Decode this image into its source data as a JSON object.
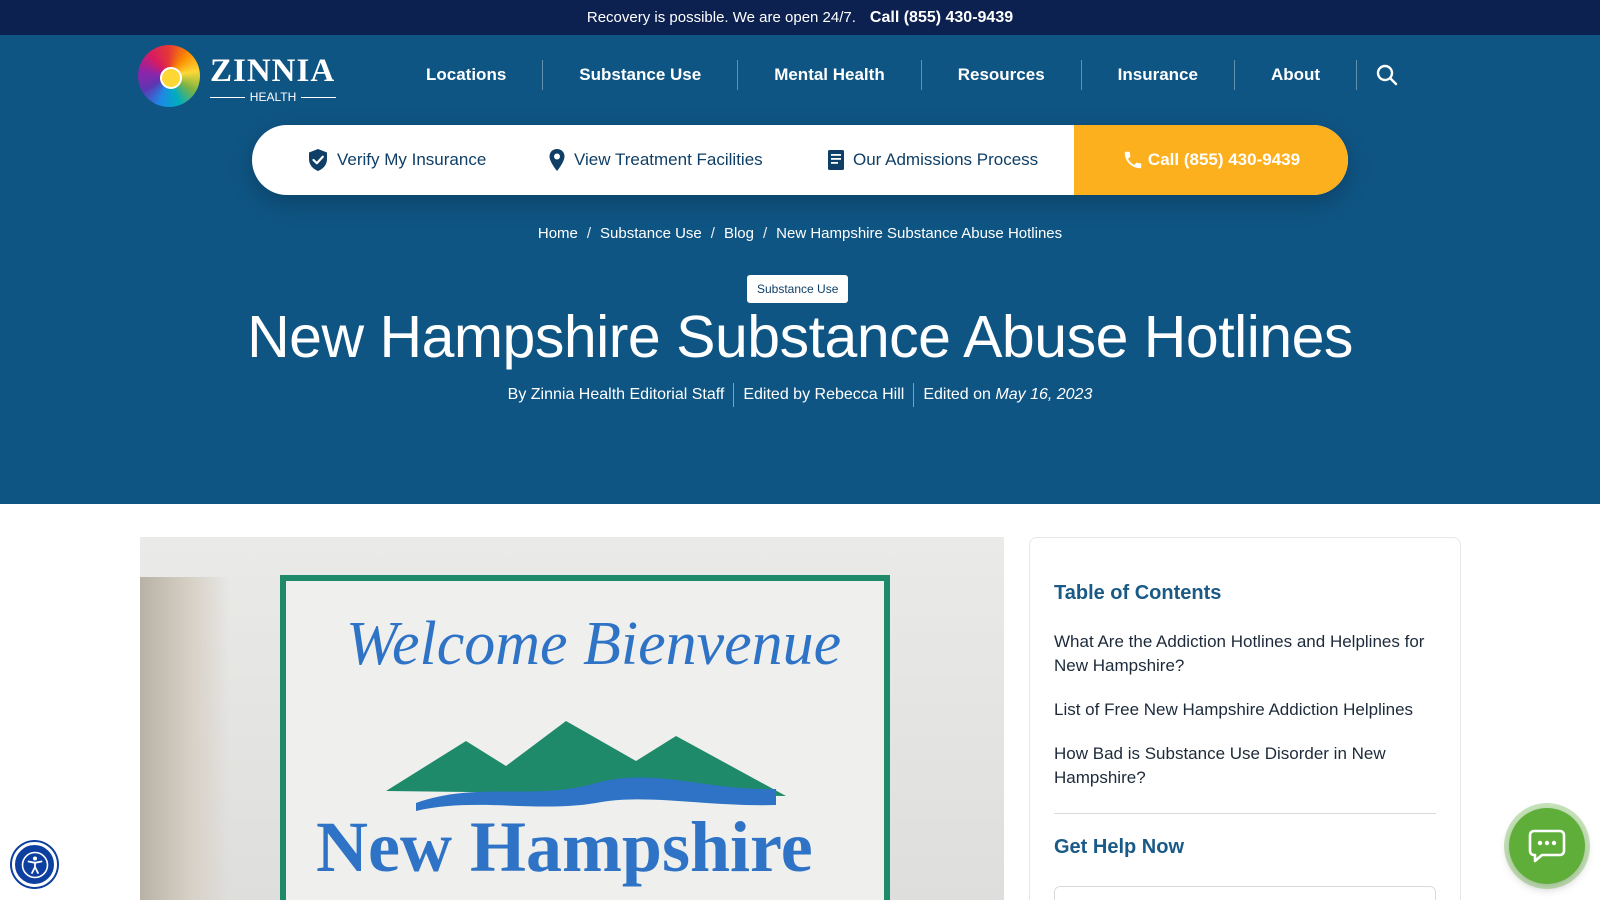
{
  "topbar": {
    "message": "Recovery is possible. We are open 24/7.",
    "phone": "Call (855) 430-9439"
  },
  "brand": {
    "name": "ZINNIA",
    "sub": "HEALTH"
  },
  "nav": {
    "items": [
      "Locations",
      "Substance Use",
      "Mental Health",
      "Resources",
      "Insurance",
      "About"
    ]
  },
  "actions": {
    "verify": "Verify My Insurance",
    "facilities": "View Treatment Facilities",
    "admissions": "Our Admissions Process",
    "call": "Call (855) 430-9439"
  },
  "breadcrumb": [
    "Home",
    "Substance Use",
    "Blog",
    "New Hampshire Substance Abuse Hotlines"
  ],
  "tag": "Substance Use",
  "title": "New Hampshire Substance Abuse Hotlines",
  "byline": {
    "author": "By Zinnia Health Editorial Staff",
    "editor": "Edited by Rebecca Hill",
    "edited_label": "Edited on",
    "edited_date": "May 16, 2023"
  },
  "photo": {
    "sign_line1": "Welcome Bienvenue",
    "sign_line2": "New Hampshire"
  },
  "toc": {
    "heading": "Table of Contents",
    "items": [
      "What Are the Addiction Hotlines and Helplines for New Hampshire?",
      "List of Free New Hampshire Addiction Helplines",
      "How Bad is Substance Use Disorder in New Hampshire?"
    ],
    "help_heading": "Get Help Now"
  },
  "colors": {
    "topbar": "#0c2150",
    "hero": "#0f5584",
    "call_button": "#fdb01e",
    "accent_text": "#1a5a86",
    "chat": "#5fae3a"
  },
  "icons": {
    "search": "search-icon",
    "shield": "shield-check-icon",
    "pin": "map-pin-icon",
    "doc": "document-icon",
    "phone": "phone-icon",
    "accessibility": "accessibility-icon",
    "chat": "chat-icon"
  }
}
